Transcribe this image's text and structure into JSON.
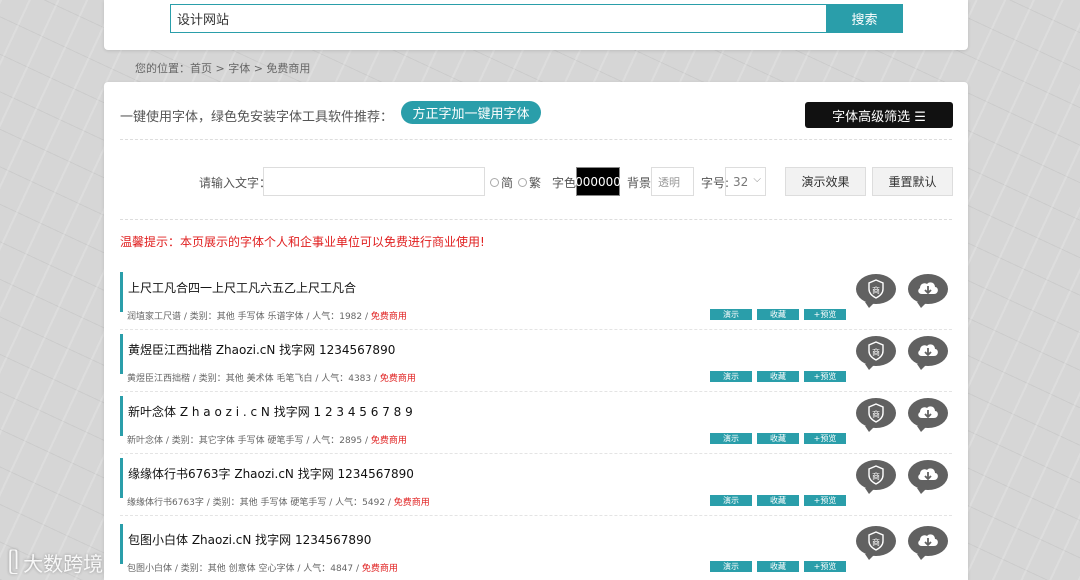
{
  "search": {
    "value": "设计网站",
    "button": "搜索"
  },
  "breadcrumb": "您的位置：首页 > 字体 > 免费商用",
  "promo": {
    "text": "一键使用字体，绿色免安装字体工具软件推荐：",
    "button": "方正字加一键用字体"
  },
  "filter_button": "字体高级筛选 ☰",
  "controls": {
    "input_label": "请输入文字：",
    "simplified": "简",
    "traditional": "繁",
    "color_label": "字色:",
    "color_value": "000000",
    "bg_label": "背景:",
    "bg_placeholder": "透明",
    "size_label": "字号:",
    "size_value": "32",
    "demo_button": "演示效果",
    "reset_button": "重置默认"
  },
  "notice": "温馨提示：本页展示的字体个人和企事业单位可以免费进行商业使用!",
  "row_buttons": {
    "demo": "演示",
    "collect": "收藏",
    "preview": "+预览"
  },
  "fonts": [
    {
      "sample": "上尺工凡合四一上尺工凡六五乙上尺工凡合",
      "meta": "润埴家工尺谱 / 类别：其他 手写体 乐谱字体 / 人气：1982 / ",
      "free": "免费商用",
      "color": "#111111"
    },
    {
      "sample": "黄煜臣江西拙楷 Zhaozi.cN 找字网 1234567890",
      "meta": "黄煜臣江西拙楷 / 类别：其他 美术体 毛笔飞白 / 人气：4383 / ",
      "free": "免费商用",
      "color": "#ee4400"
    },
    {
      "sample": "新叶念体 Z h a o z i . c N 找字网 1 2 3 4 5 6 7 8 9",
      "meta": "新叶念体 / 类别：其它字体 手写体 硬笔手写 / 人气：2895 / ",
      "free": "免费商用",
      "color": "#111111"
    },
    {
      "sample": "缘缘体行书6763字  Zhaozi.cN  找字网  1234567890",
      "meta": "缘缘体行书6763字 / 类别：其他 手写体 硬笔手写 / 人气：5492 / ",
      "free": "免费商用",
      "color": "#111111"
    },
    {
      "sample": "包图小白体 Zhaozi.cN 找字网 1234567890",
      "meta": "包图小白体 / 类别：其他 创意体 空心字体 / 人气：4847 / ",
      "free": "免费商用",
      "color": "#111111"
    }
  ],
  "watermark": "大数跨境",
  "accent_color": "#2a9eaa",
  "warning_color": "#e02020"
}
